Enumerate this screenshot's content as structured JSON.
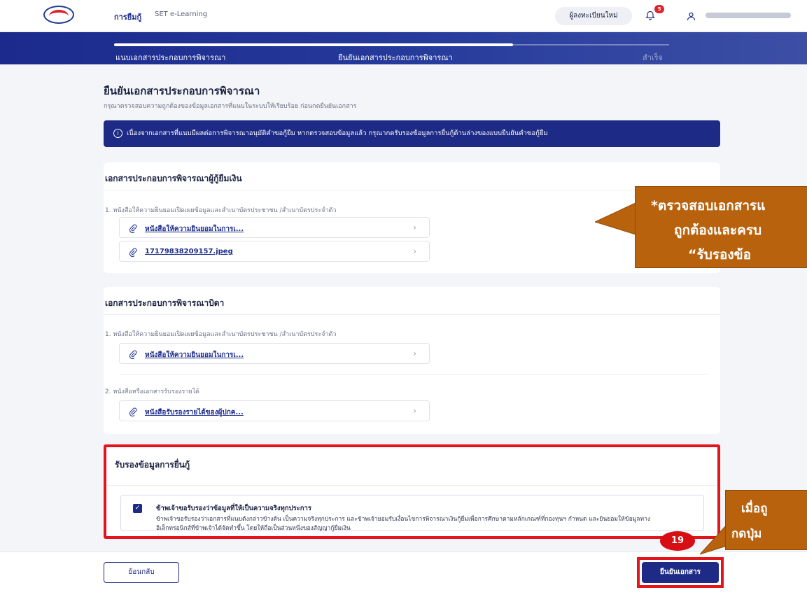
{
  "nav": {
    "active_link": "การยืมกู้",
    "secondary_link": "SET e-Learning",
    "register_button": "ผู้ลงทะเบียนใหม่",
    "notification_count": "5"
  },
  "stepper": {
    "steps": [
      "แนบเอกสารประกอบการพิจารณา",
      "ยืนยันเอกสารประกอบการพิจารณา",
      "สำเร็จ"
    ]
  },
  "page": {
    "title": "ยืนยันเอกสารประกอบการพิจารณา",
    "subtitle": "กรุณาตรวจสอบความถูกต้องของข้อมูลเอกสารที่แนบในระบบให้เรียบร้อย ก่อนกดยืนยันเอกสาร",
    "info_banner": "เนื่องจากเอกสารที่แนบมีผลต่อการพิจารณาอนุมัติคำขอกู้ยืม หากตรวจสอบข้อมูลแล้ว กรุณากดรับรองข้อมูลการยื่นกู้ด้านล่างของแบบยืนยันคำขอกู้ยืม"
  },
  "borrower_card": {
    "title": "เอกสารประกอบการพิจารณาผู้กู้ยืมเงิน",
    "doc_label": "1. หนังสือให้ความยินยอมเปิดเผยข้อมูลและสำเนาบัตรประชาชน /สำเนาบัตรประจำตัว",
    "files": [
      "หนังสือให้ความยินยอมในการเ...",
      "17179838209157.jpeg"
    ]
  },
  "father_card": {
    "title": "เอกสารประกอบการพิจารณาบิดา",
    "doc_label_1": "1. หนังสือให้ความยินยอมเปิดเผยข้อมูลและสำเนาบัตรประชาชน /สำเนาบัตรประจำตัว",
    "file_1": "หนังสือให้ความยินยอมในการเ...",
    "doc_label_2": "2. หนังสือหรือเอกสารรับรองรายได้",
    "file_2": "หนังสือรับรองรายได้ของผู้ปกค..."
  },
  "consent": {
    "title": "รับรองข้อมูลการยื่นกู้",
    "heading": "ข้าพเจ้าขอรับรองว่าข้อมูลที่ให้เป็นความจริงทุกประการ",
    "text": "ข้าพเจ้าขอรับรองว่าเอกสารที่แนบดังกล่าวข้างต้น เป็นความจริงทุกประการ และข้าพเจ้ายอมรับเงื่อนไขการพิจารณาเงินกู้ยืมเพื่อการศึกษาตามหลักเกณฑ์ที่กองทุนฯ กำหนด และยินยอมให้ข้อมูลทางอิเล็กทรอนิกส์ที่ข้าพเจ้าได้จัดทำขึ้น โดยให้ถือเป็นส่วนหนึ่งของสัญญากู้ยืมเงิน",
    "checked": true
  },
  "footer": {
    "back_button": "ย้อนกลับ",
    "confirm_button": "ยืนยันเอกสาร"
  },
  "annotations": {
    "callout_1_lines": [
      "*ตรวจสอบเอกสารแ",
      "ถูกต้องและครบ",
      "“รับรองข้อ"
    ],
    "callout_2_lines": [
      "เมื่อถู",
      "กดปุ่ม"
    ],
    "step_number": "19"
  },
  "colors": {
    "primary": "#1d2b86",
    "highlight_red": "#e3141b",
    "callout_orange": "#b8620d"
  }
}
